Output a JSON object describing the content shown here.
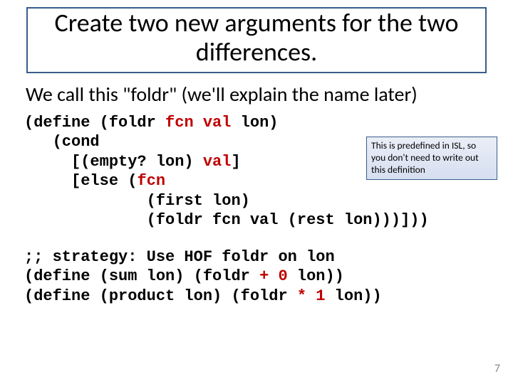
{
  "title": "Create two new arguments for the two differences.",
  "subhead": "We call this \"foldr\" (we'll explain the name later)",
  "code1": {
    "l1a": "(define (foldr ",
    "l1b": "fcn val",
    "l1c": " lon)",
    "l2": "   (cond",
    "l3a": "     [(empty? lon) ",
    "l3b": "val",
    "l3c": "]",
    "l4a": "     [else (",
    "l4b": "fcn",
    "l5": "             (first lon)",
    "l6": "             (foldr fcn val (rest lon)))]))"
  },
  "code2": {
    "l1": ";; strategy: Use HOF foldr on lon",
    "l2a": "(define (sum lon) (foldr ",
    "l2b": "+ 0",
    "l2c": " lon))",
    "l3a": "(define (product lon) (foldr ",
    "l3b": "* 1",
    "l3c": " lon))"
  },
  "note": "This is predefined in ISL, so you don't need to write out this definition",
  "page": "7"
}
